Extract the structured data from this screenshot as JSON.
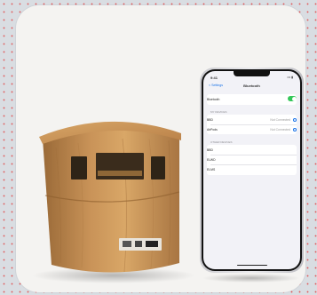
{
  "photo": {
    "subject": "wooden-speaker-with-smartphone",
    "colors": {
      "background": "#f4f3f1",
      "wood": "#c08a4e",
      "wood_dark": "#7a5128",
      "phone_frame": "#d8d8dc",
      "screen": "#f2f2f7",
      "toggle_on": "#34c759"
    }
  },
  "phone_screen": {
    "status_time": "9:41",
    "status_right": "••• ▮",
    "back_label": "< Settings",
    "title": "Bluetooth",
    "bluetooth_label": "Bluetooth",
    "my_devices_header": "MY DEVICES",
    "device_1": "BBD",
    "device_1_status": "Not Connected",
    "device_2": "AirPods",
    "device_2_status": "Not Connected",
    "other_devices_header": "OTHER DEVICES",
    "other_1": "BBD",
    "other_2": "ELWD",
    "other_3": "ELMS"
  }
}
